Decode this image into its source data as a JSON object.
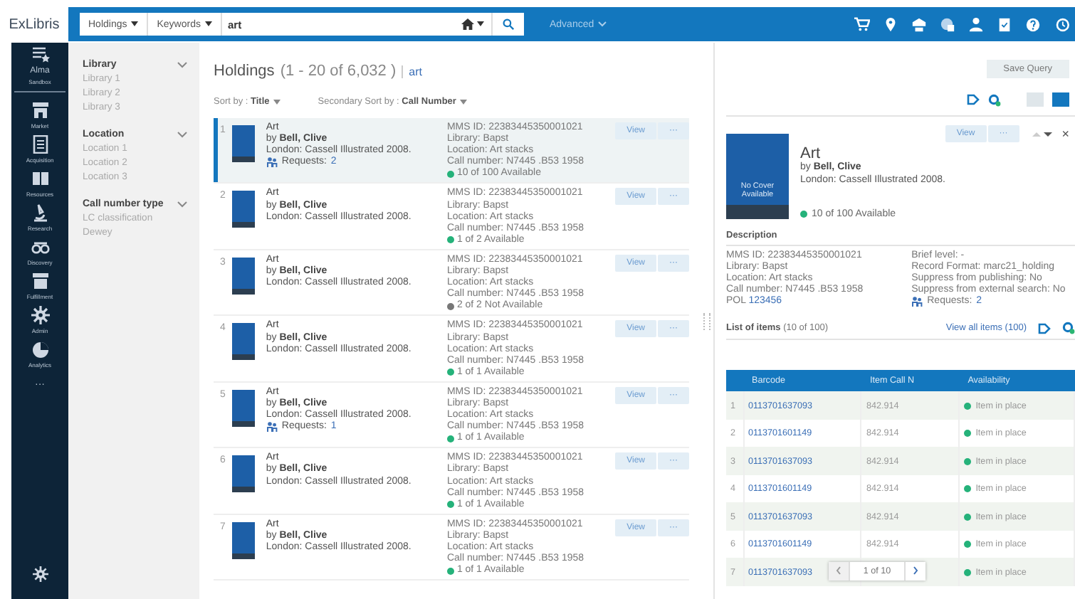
{
  "header": {
    "logo": "ExLibris",
    "scope": "Holdings",
    "field": "Keywords",
    "query": "art",
    "advanced": "Advanced"
  },
  "nav": [
    {
      "label": "Alma",
      "sub": "Sandbox"
    },
    {
      "label": "Market"
    },
    {
      "label": "Acquisition"
    },
    {
      "label": "Resources"
    },
    {
      "label": "Research"
    },
    {
      "label": "Discovery"
    },
    {
      "label": "Fulfillment"
    },
    {
      "label": "Admin"
    },
    {
      "label": "Analytics"
    }
  ],
  "nav_more": "···",
  "facets": [
    {
      "title": "Library",
      "expanded": true,
      "items": [
        "Library 1",
        "Library 2",
        "Library 3"
      ]
    },
    {
      "title": "Location",
      "expanded": true,
      "items": [
        "Location 1",
        "Location 2",
        "Location 3"
      ]
    },
    {
      "title": "Call number type",
      "expanded": true,
      "items": [
        "LC classification",
        "Dewey"
      ]
    }
  ],
  "results": {
    "title": "Holdings",
    "count": "(1 - 20 of 6,032 )",
    "query": "art",
    "save": "Save Query",
    "sort": "Sort by : **Title**",
    "sort2": "Secondary Sort by : **Call Number**"
  },
  "rows": [
    {
      "num": "1",
      "selected": true,
      "view": "View",
      "more": "···",
      "title": "Art",
      "author": "by **Bell, Clive**",
      "pub": "London: Cassell Illustrated 2008.",
      "requests": "Requests:",
      "requests_count": "2",
      "lines": [
        "MMS ID: 22383445350001021",
        "Library: Bapst",
        "Location: Art stacks",
        "Call number: N7445 .B53 1958"
      ],
      "avail": "10 of 100 Available",
      "available": true
    },
    {
      "num": "2",
      "selected": false,
      "view": "View",
      "more": "···",
      "title": "Art",
      "author": "by **Bell, Clive**",
      "pub": "London: Cassell Illustrated 2008.",
      "lines": [
        "MMS ID: 22383445350001021",
        "Library: Bapst",
        "Location: Art stacks",
        "Call number: N7445 .B53 1958"
      ],
      "avail": "1 of 2 Available",
      "available": true
    },
    {
      "num": "3",
      "selected": false,
      "view": "View",
      "more": "···",
      "title": "Art",
      "author": "by **Bell, Clive**",
      "pub": "London: Cassell Illustrated 2008.",
      "lines": [
        "MMS ID: 22383445350001021",
        "Library: Bapst",
        "Location: Art stacks",
        "Call number: N7445 .B53 1958"
      ],
      "avail": "2 of 2 Not Available",
      "available": false
    },
    {
      "num": "4",
      "selected": false,
      "view": "View",
      "more": "···",
      "title": "Art",
      "author": "by **Bell, Clive**",
      "pub": "London: Cassell Illustrated 2008.",
      "lines": [
        "MMS ID: 22383445350001021",
        "Library: Bapst",
        "Location: Art stacks",
        "Call number: N7445 .B53 1958"
      ],
      "avail": "1 of 1 Available",
      "available": true
    },
    {
      "num": "5",
      "selected": false,
      "view": "View",
      "more": "···",
      "title": "Art",
      "author": "by **Bell, Clive**",
      "pub": "London: Cassell Illustrated 2008.",
      "requests": "Requests:",
      "requests_count": "1",
      "lines": [
        "MMS ID: 22383445350001021",
        "Library: Bapst",
        "Location: Art stacks",
        "Call number: N7445 .B53 1958"
      ],
      "avail": "1 of 1 Available",
      "available": true
    },
    {
      "num": "6",
      "selected": false,
      "view": "View",
      "more": "···",
      "title": "Art",
      "author": "by **Bell, Clive**",
      "pub": "London: Cassell Illustrated 2008.",
      "lines": [
        "MMS ID: 22383445350001021",
        "Library: Bapst",
        "Location: Art stacks",
        "Call number: N7445 .B53 1958"
      ],
      "avail": "1 of 1 Available",
      "available": true
    },
    {
      "num": "7",
      "selected": false,
      "view": "View",
      "more": "···",
      "title": "Art",
      "author": "by **Bell, Clive**",
      "pub": "London: Cassell Illustrated 2008.",
      "lines": [
        "MMS ID: 22383445350001021",
        "Library: Bapst",
        "Location: Art stacks",
        "Call number: N7445 .B53 1958"
      ],
      "avail": "1 of 1 Available",
      "available": true
    }
  ],
  "detail": {
    "view": "View",
    "more": "···",
    "close": "×",
    "cover": "No Cover Available",
    "title": "Art",
    "author": "by **Bell, Clive**",
    "pub": "London: Cassell Illustrated 2008.",
    "avail": "10 of 100 Available",
    "available": true,
    "desc_title": "Description",
    "desc_left": [
      "MMS ID: 22383445350001021",
      "Library: Bapst",
      "Location: Art stacks",
      "Call number: N7445 .B53 1958"
    ],
    "pol_label": "POL",
    "pol": "123456",
    "desc_right": [
      "Brief level: -",
      "Record Format: marc21_holding",
      "Suppress from publishing: No",
      "Suppress from external search: No"
    ],
    "requests": "Requests:",
    "requests_count": "2",
    "items_title": "**List of items** (10 of 100)",
    "view_all": "View all items (100)",
    "columns": [
      "Barcode",
      "Item Call N",
      "Availability"
    ],
    "items": [
      {
        "num": "1",
        "barcode": "0113701637093",
        "call": "842.914",
        "status": "Item in place"
      },
      {
        "num": "2",
        "barcode": "0113701601149",
        "call": "842.914",
        "status": "Item in place"
      },
      {
        "num": "3",
        "barcode": "0113701637093",
        "call": "842.914",
        "status": "Item in place"
      },
      {
        "num": "4",
        "barcode": "0113701601149",
        "call": "842.914",
        "status": "Item in place"
      },
      {
        "num": "5",
        "barcode": "0113701637093",
        "call": "842.914",
        "status": "Item in place"
      },
      {
        "num": "6",
        "barcode": "0113701601149",
        "call": "842.914",
        "status": "Item in place"
      },
      {
        "num": "7",
        "barcode": "0113701637093",
        "status": "Item in place"
      }
    ],
    "pager": "1 of 10"
  }
}
